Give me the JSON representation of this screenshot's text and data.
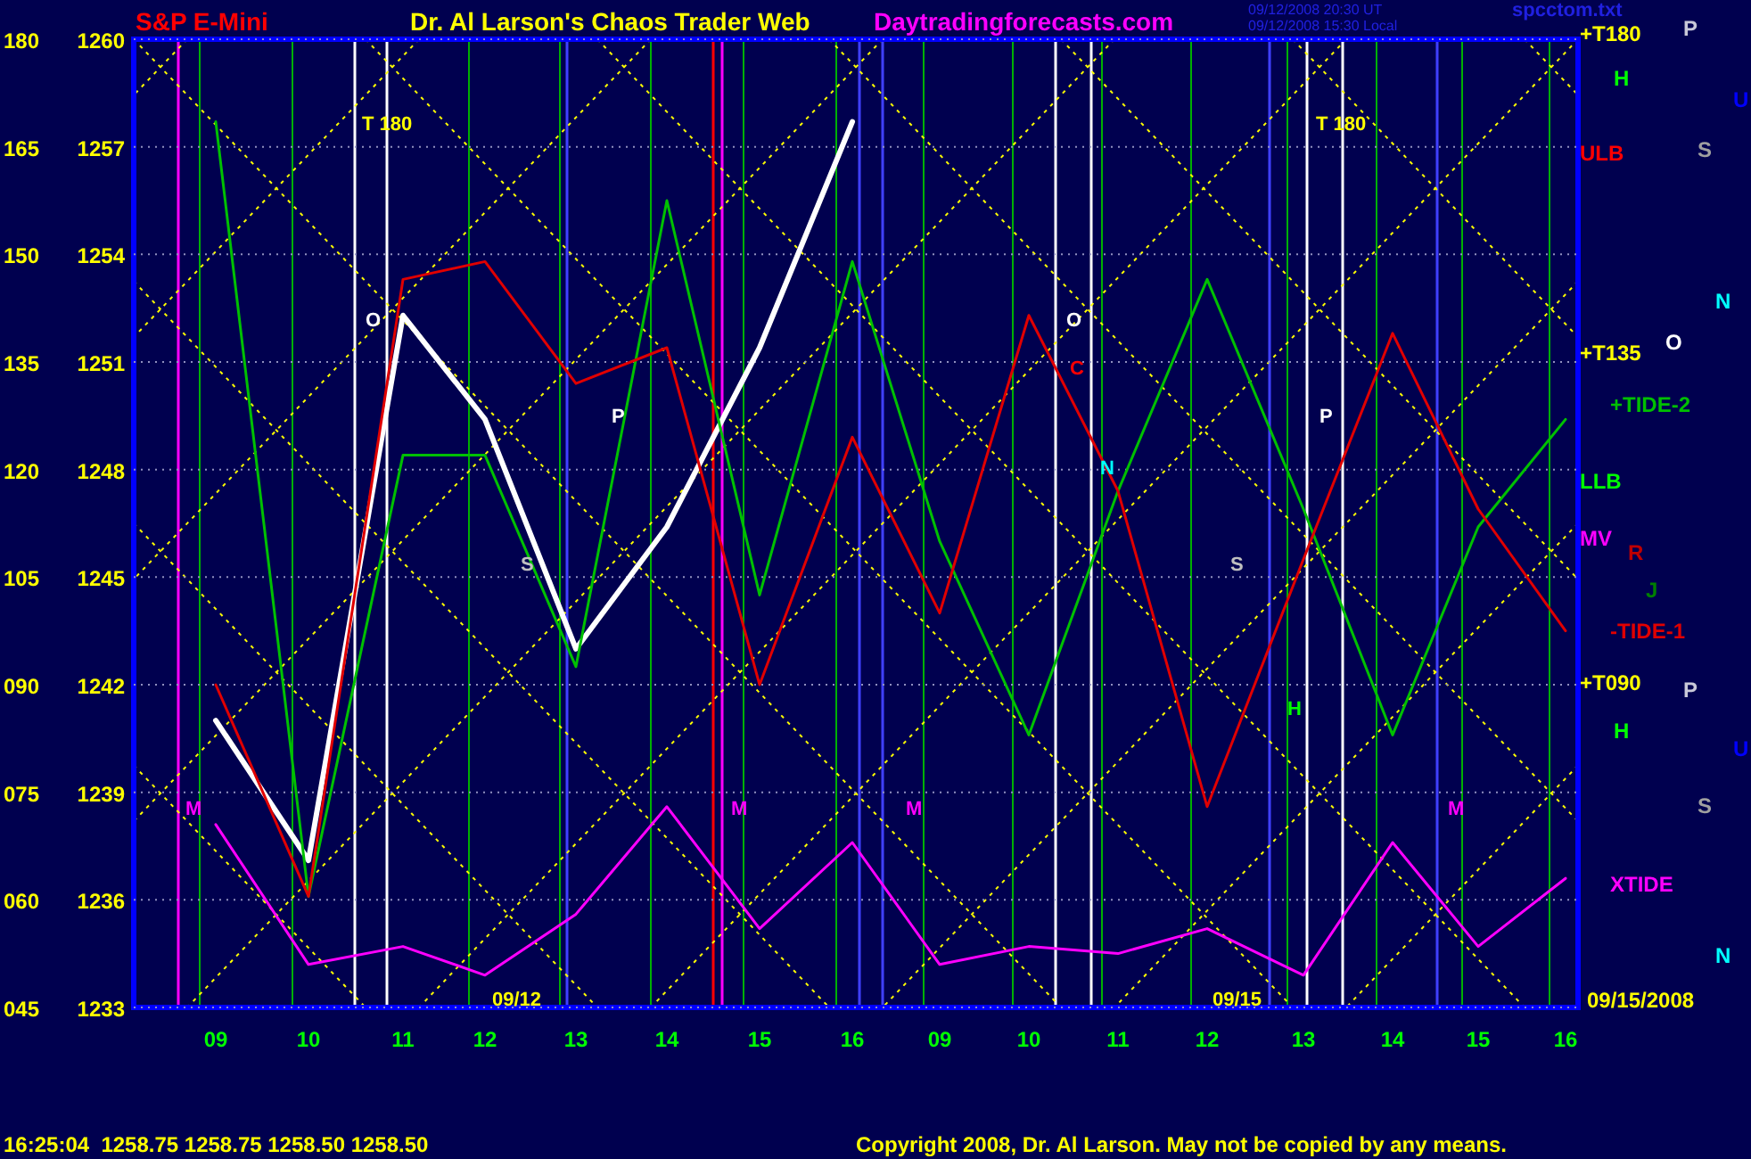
{
  "header": {
    "title": "Dr. Al Larson's Chaos Trader Web",
    "site": "Daytradingforecasts.com",
    "timestamp_ut": "09/12/2008 20:30 UT",
    "timestamp_local": "09/12/2008 15:30 Local",
    "file": "spcctom.txt"
  },
  "chart": {
    "y_counts": [
      "180",
      "165",
      "150",
      "135",
      "120",
      "105",
      "090",
      "075",
      "060",
      "045"
    ],
    "chart_data": {
      "type": "line",
      "categories": [
        "09",
        "10",
        "11",
        "12",
        "13",
        "14",
        "15",
        "16",
        "09",
        "10",
        "11",
        "12",
        "13",
        "14",
        "15",
        "16"
      ],
      "yticks": [
        1260,
        1257,
        1254,
        1251,
        1248,
        1245,
        1242,
        1239,
        1236,
        1233
      ],
      "ylim": [
        1233,
        1260
      ],
      "grid": true,
      "series": [
        {
          "name": "S&P E-Mini",
          "color": "#ffffff",
          "values": [
            1241.0,
            1237.1,
            1252.3,
            1249.4,
            1243.0,
            1246.4,
            1251.4,
            1257.7,
            null,
            null,
            null,
            null,
            null,
            null,
            null,
            null
          ]
        },
        {
          "name": "+TIDE-2",
          "color": "#00c000",
          "values": [
            1257.7,
            1236.1,
            1248.4,
            1248.4,
            1242.5,
            1255.5,
            1244.5,
            1253.8,
            1246.0,
            1240.6,
            1247.4,
            1253.3,
            1246.9,
            1240.6,
            1246.4,
            1249.4
          ]
        },
        {
          "name": "-TIDE-1",
          "color": "#e00000",
          "values": [
            1242.0,
            1236.1,
            1253.3,
            1253.8,
            1250.4,
            1251.4,
            1242.0,
            1248.9,
            1244.0,
            1252.3,
            1247.4,
            1238.6,
            1245.5,
            1251.8,
            1246.9,
            1243.5
          ]
        },
        {
          "name": "XTIDE",
          "color": "#ff00ff",
          "values": [
            1238.1,
            1234.2,
            1234.7,
            1233.9,
            1235.6,
            1238.6,
            1235.2,
            1237.6,
            1234.2,
            1234.7,
            1234.5,
            1235.2,
            1233.9,
            1237.6,
            1234.7,
            1236.6
          ]
        }
      ]
    },
    "plot_labels": [
      {
        "text": "T 180",
        "color": "#ffff00"
      },
      {
        "text": "T 180",
        "color": "#ffff00"
      },
      {
        "text": "O",
        "color": "#ffffff"
      },
      {
        "text": "O",
        "color": "#ffffff"
      },
      {
        "text": "C",
        "color": "#ff0000"
      },
      {
        "text": "P",
        "color": "#ffffff"
      },
      {
        "text": "P",
        "color": "#ffffff"
      },
      {
        "text": "N",
        "color": "#00ffff"
      },
      {
        "text": "S",
        "color": "#c0c0c0"
      },
      {
        "text": "S",
        "color": "#c0c0c0"
      },
      {
        "text": "H",
        "color": "#00ff00"
      },
      {
        "text": "M",
        "color": "#ff00ff"
      },
      {
        "text": "M",
        "color": "#ff00ff"
      },
      {
        "text": "M",
        "color": "#ff00ff"
      },
      {
        "text": "M",
        "color": "#ff00ff"
      },
      {
        "text": "09/12",
        "color": "#ffff00"
      },
      {
        "text": "09/15",
        "color": "#ffff00"
      }
    ],
    "side_labels": [
      {
        "text": "+T180",
        "color": "#ffff00"
      },
      {
        "text": "P",
        "color": "#c8c8d8"
      },
      {
        "text": "H",
        "color": "#00ff00"
      },
      {
        "text": "U",
        "color": "#0000ff"
      },
      {
        "text": "ULB",
        "color": "#ff0000"
      },
      {
        "text": "S",
        "color": "#a0a0a0"
      },
      {
        "text": "N",
        "color": "#00ffff"
      },
      {
        "text": "O",
        "color": "#ffffff"
      },
      {
        "text": "+T135",
        "color": "#ffff00"
      },
      {
        "text": "LLB",
        "color": "#00ff00"
      },
      {
        "text": "MV",
        "color": "#ff00ff"
      },
      {
        "text": "R",
        "color": "#c00000"
      },
      {
        "text": "J",
        "color": "#008000"
      },
      {
        "text": "+T090",
        "color": "#ffff00"
      },
      {
        "text": "P",
        "color": "#c8c8d8"
      },
      {
        "text": "H",
        "color": "#00ff00"
      },
      {
        "text": "U",
        "color": "#0000ff"
      },
      {
        "text": "S",
        "color": "#a0a0a0"
      },
      {
        "text": "N",
        "color": "#00ffff"
      },
      {
        "text": "09/15/2008",
        "color": "#ffff00"
      }
    ]
  },
  "status_bar": {
    "quote": "16:25:04  1258.75 1258.75 1258.50 1258.50",
    "copyright": "Copyright 2008, Dr. Al Larson. May not be copied by any means."
  }
}
